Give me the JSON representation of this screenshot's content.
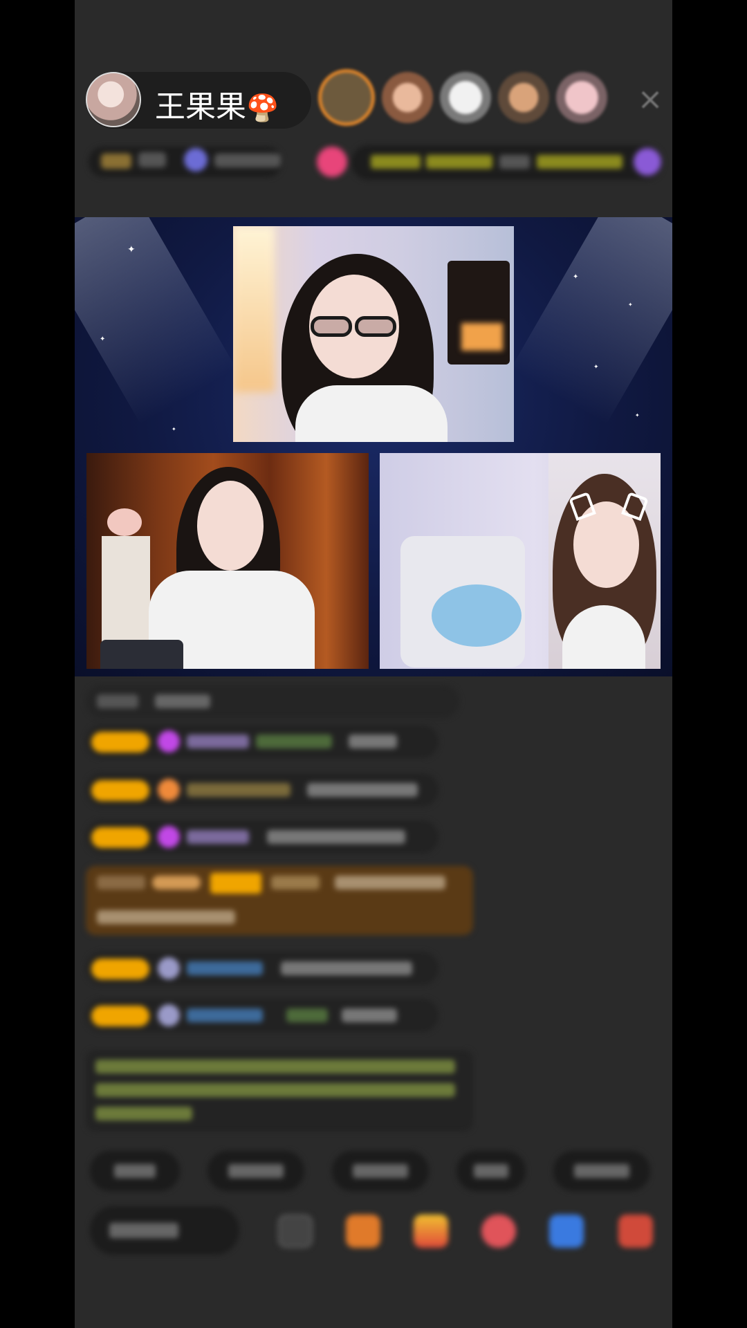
{
  "host": {
    "name": "王果果",
    "name_emoji": "🍄",
    "avatar_icon": "host-avatar"
  },
  "header": {
    "close_icon": "×"
  },
  "stage": {
    "background": "#101942"
  },
  "chat": {
    "level_badge_color": "#f0a500"
  },
  "icons": [
    "close-icon",
    "gift-icon",
    "more-icon"
  ]
}
